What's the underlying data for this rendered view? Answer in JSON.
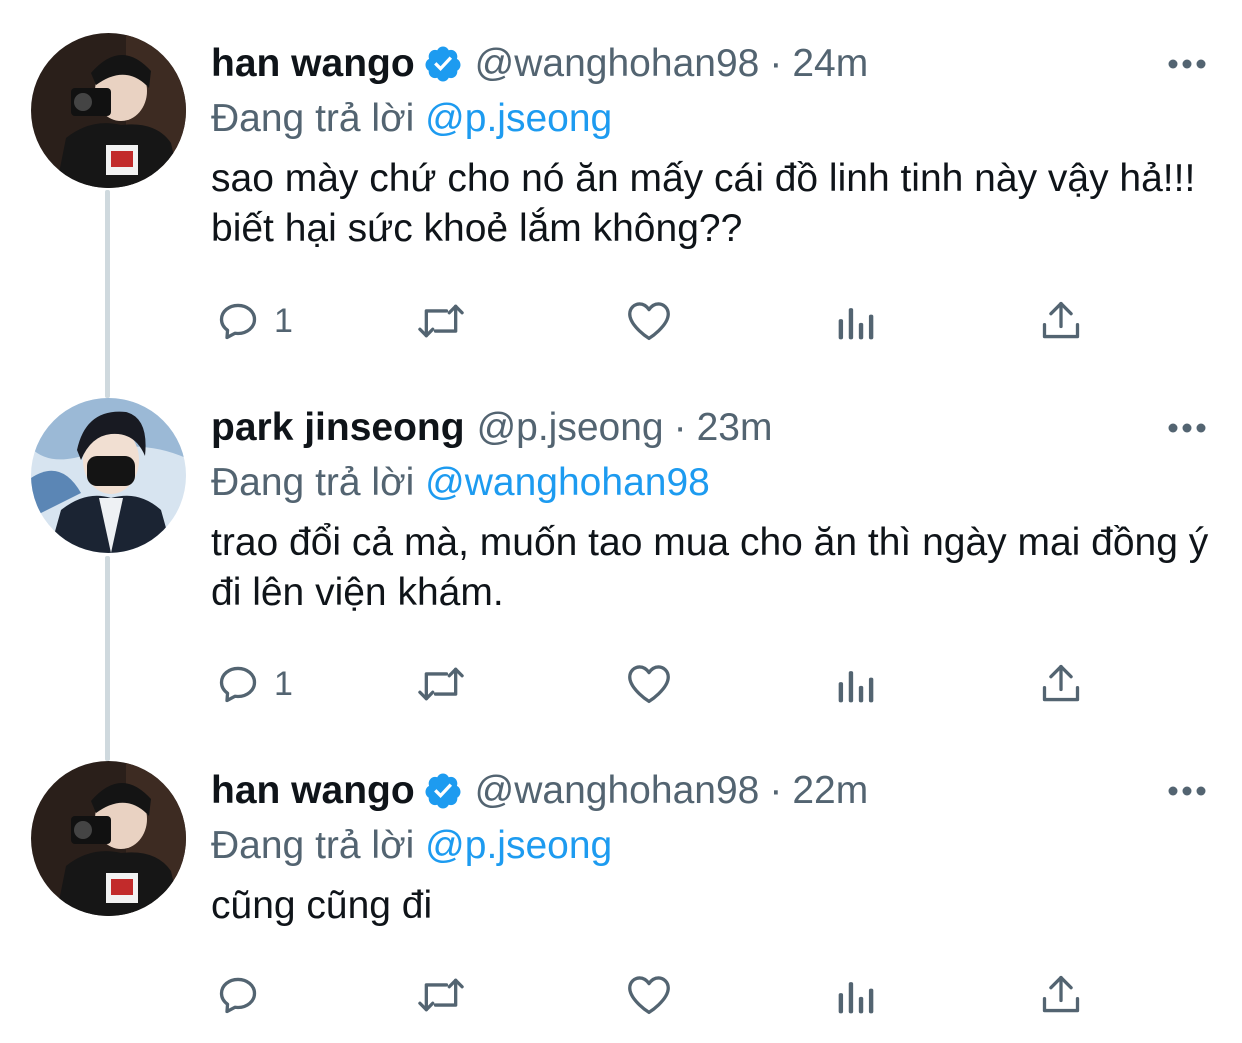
{
  "tweets": [
    {
      "name": "han wango",
      "verified": true,
      "handle": "@wanghohan98",
      "separator": "·",
      "time": "24m",
      "replying_prefix": "Đang trả lời",
      "replying_to": "@p.jseong",
      "text": "sao mày chứ cho nó ăn mấy cái đồ linh tinh này vậy hả!!! biết hại sức khoẻ lắm không??",
      "reply_count": "1"
    },
    {
      "name": "park jinseong",
      "verified": false,
      "handle": "@p.jseong",
      "separator": "·",
      "time": "23m",
      "replying_prefix": "Đang trả lời",
      "replying_to": "@wanghohan98",
      "text": "trao đổi cả mà, muốn tao mua cho ăn thì ngày mai đồng ý đi lên viện khám.",
      "reply_count": "1"
    },
    {
      "name": "han wango",
      "verified": true,
      "handle": "@wanghohan98",
      "separator": "·",
      "time": "22m",
      "replying_prefix": "Đang trả lời",
      "replying_to": "@p.jseong",
      "text": "cũng cũng đi",
      "reply_count": ""
    }
  ],
  "icons": {
    "reply": "speech-bubble-icon",
    "retweet": "retweet-arrows-icon",
    "like": "heart-icon",
    "analytics": "bar-chart-icon",
    "share": "share-upload-icon",
    "more": "ellipsis-icon",
    "verified": "verified-badge-icon"
  },
  "colors": {
    "text": "#0f1419",
    "secondary": "#536471",
    "accent": "#1d9bf0",
    "thread_line": "#cfd9de"
  }
}
